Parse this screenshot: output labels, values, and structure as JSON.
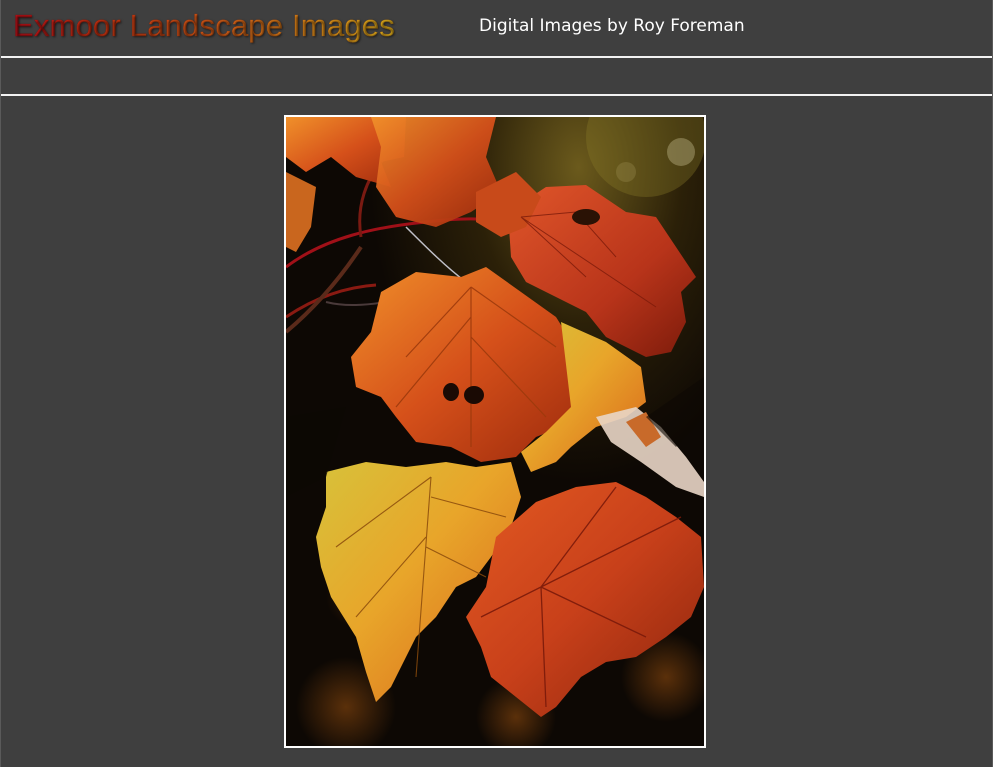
{
  "header": {
    "site_title": "Exmoor Landscape Images",
    "subtitle": "Digital Images by Roy Foreman"
  },
  "photo": {
    "subject": "autumn-leaves-photo"
  },
  "colors": {
    "background": "#3f3f3f",
    "rule": "#f2f2f2",
    "frame": "#ffffff",
    "title_gradient_start": "#c8101a",
    "title_gradient_end": "#f5c21f",
    "subtitle_text": "#ffffff"
  }
}
